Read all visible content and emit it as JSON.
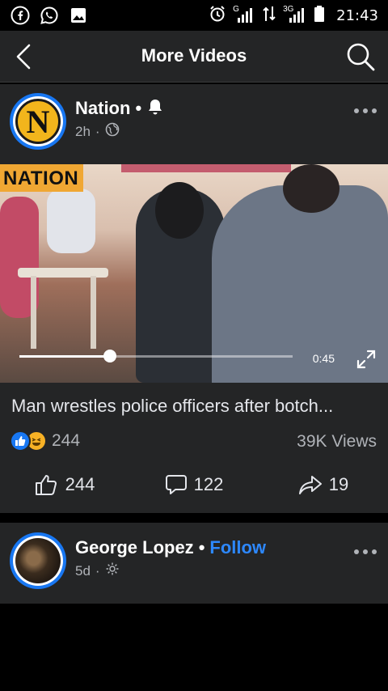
{
  "status_bar": {
    "time": "21:43",
    "left_icons": [
      "facebook-icon",
      "whatsapp-icon",
      "gallery-icon"
    ],
    "right_icons": [
      "alarm-icon",
      "signal-g-icon",
      "data-arrows-icon",
      "signal-3g-icon",
      "battery-icon"
    ],
    "signal_g_label": "G",
    "signal_3g_label": "3G"
  },
  "header": {
    "title": "More Videos",
    "back_icon": "chevron-left-icon",
    "search_icon": "search-icon"
  },
  "posts": [
    {
      "page_name": "Nation",
      "logo_letter": "N",
      "time": "2h",
      "audience_icon": "globe-icon",
      "bell_icon": "bell-icon",
      "video": {
        "badge": "NATION",
        "elapsed": "0:45",
        "progress": 0.33
      },
      "title": "Man wrestles police officers after botch...",
      "reaction_count": "244",
      "views": "39K Views",
      "actions": {
        "like_count": "244",
        "comment_count": "122",
        "share_count": "19"
      }
    },
    {
      "page_name": "George Lopez",
      "follow_label": "Follow",
      "time": "5d",
      "audience_icon": "settings-icon"
    }
  ],
  "colors": {
    "card_bg": "#242526",
    "page_bg": "#000000",
    "accent_blue": "#2d88ff",
    "muted_text": "#b0b3b8",
    "nation_yellow": "#f2b51c",
    "nation_badge": "#f0a733"
  }
}
